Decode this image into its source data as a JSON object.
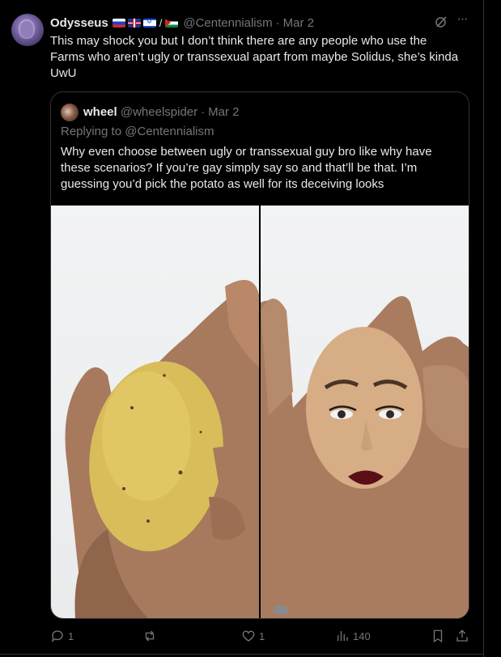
{
  "post": {
    "author_name": "Odysseus",
    "author_flags": [
      "russia-flag",
      "uk-flag",
      "israel-flag",
      "palestine-flag"
    ],
    "flag_separator": "/",
    "author_handle": "@Centennialism",
    "separator": "·",
    "date": "Mar 2",
    "text": "This may shock you but I don’t think there are any people who use the\nFarms who aren’t ugly or transsexual apart from maybe Solidus, she’s kinda\nUwU"
  },
  "quote": {
    "author_name": "wheel",
    "author_handle": "@wheelspider",
    "separator": "·",
    "date": "Mar 2",
    "replying_prefix": "Replying to",
    "replying_to": "@Centennialism",
    "text": "Why even choose between ugly or transsexual guy bro like why have\nthese scenarios? If you’re gay simply say so and that’ll be that. I’m\nguessing you’d pick the potato as well for its deceiving looks",
    "media": [
      "hand-holding-potato-photo",
      "hand-holding-potato-with-makeup-face-photo"
    ]
  },
  "actions": {
    "reply_count": "1",
    "repost_count": "",
    "like_count": "1",
    "views_count": "140"
  },
  "colors": {
    "background": "#000000",
    "text": "#e7e9ea",
    "muted": "#71767b",
    "border": "#2f3336"
  }
}
